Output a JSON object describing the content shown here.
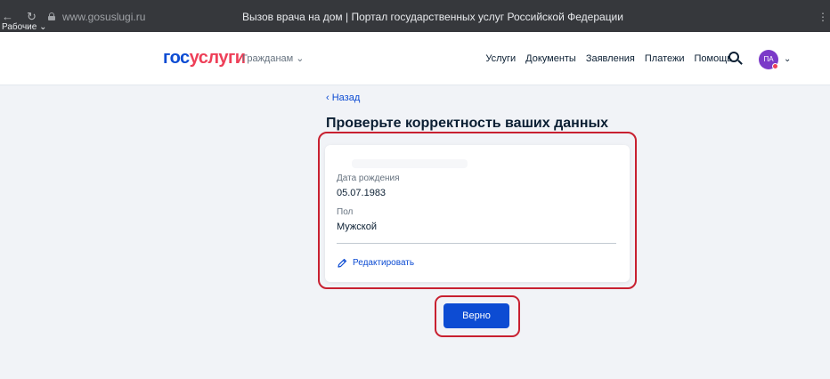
{
  "browser": {
    "back_glyph": "←",
    "reload_glyph": "↻",
    "url": "www.gosuslugi.ru",
    "title": "Вызов врача на дом | Портал государственных услуг Российской Федерации",
    "menu_glyph": "⋮",
    "bookmarks_label": "Рабочие ⌄"
  },
  "header": {
    "logo_part1": "гос",
    "logo_part2": "услуги",
    "citizens_menu": "Гражданам ⌄",
    "nav": [
      "Услуги",
      "Документы",
      "Заявления",
      "Платежи",
      "Помощь"
    ],
    "avatar_initials": "ПА",
    "avatar_chevron": "⌄"
  },
  "main": {
    "back_link": "‹ Назад",
    "heading": "Проверьте корректность ваших данных",
    "fields": [
      {
        "label": "Дата рождения",
        "value": "05.07.1983"
      },
      {
        "label": "Пол",
        "value": "Мужской"
      }
    ],
    "edit_label": "Редактировать",
    "confirm_button": "Верно"
  },
  "colors": {
    "brand_blue": "#0d4cd3",
    "brand_red": "#ee3f58",
    "highlight": "#c82030",
    "background": "#f1f3f7"
  }
}
